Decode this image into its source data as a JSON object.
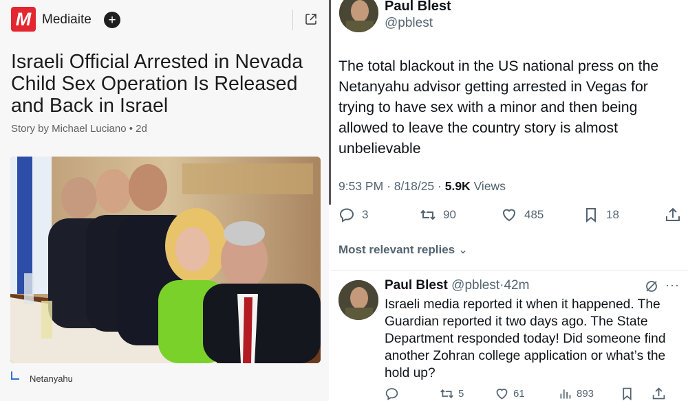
{
  "article": {
    "logo_letter": "M",
    "publisher": "Mediaite",
    "headline": "Israeli Official Arrested in Nevada Child Sex Operation Is Released and Back in Israel",
    "byline": "Story by Michael Luciano • 2d",
    "caption": "Netanyahu",
    "icons": {
      "follow": "plus-icon",
      "open": "external-link-icon",
      "caption": "caption-corner-icon"
    },
    "colors": {
      "brand": "#e3262f",
      "caption_accent": "#2f6fd0"
    }
  },
  "tweet": {
    "author_name": "Paul Blest",
    "author_handle": "@pblest",
    "text": "The total blackout in the US national press on the Netanyahu advisor getting arrested in Vegas for trying to have sex with a minor and then being allowed to leave the country story is almost unbelievable",
    "time": "9:53 PM",
    "date": "8/18/25",
    "views_count": "5.9K",
    "views_label": "Views",
    "replies": "3",
    "reposts": "90",
    "likes": "485",
    "bookmarks": "18",
    "replies_sort_label": "Most relevant replies"
  },
  "reply": {
    "author_name": "Paul Blest",
    "author_handle": "@pblest",
    "age": "42m",
    "text": "Israeli media reported it when it happened. The Guardian reported it two days ago. The State Department responded today! Did someone find another Zohran college application or what’s the hold up?",
    "replies": "",
    "reposts": "5",
    "likes": "61",
    "views": "893"
  }
}
